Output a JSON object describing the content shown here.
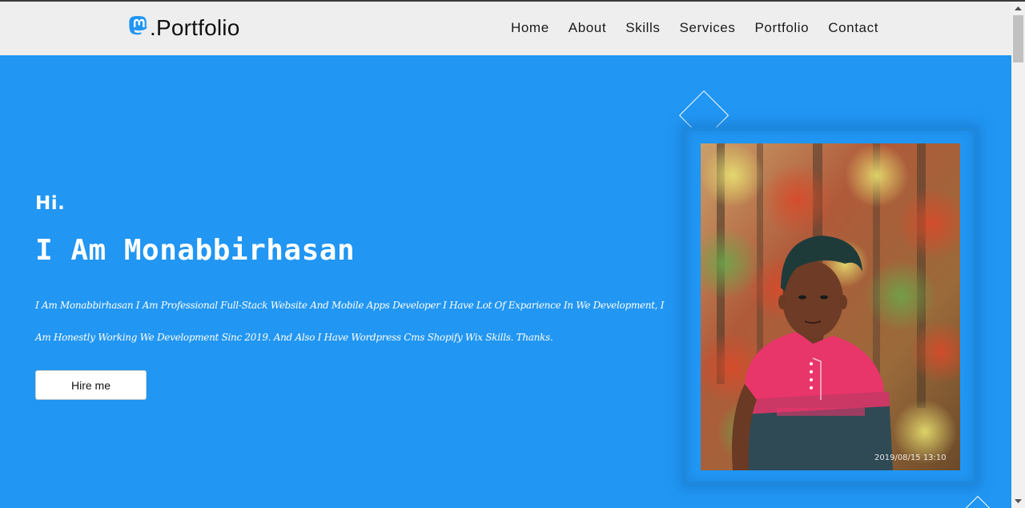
{
  "header": {
    "brand_icon": "mastodon-logo-icon",
    "brand_text": ".Portfolio",
    "nav": [
      {
        "label": "Home"
      },
      {
        "label": "About"
      },
      {
        "label": "Skills"
      },
      {
        "label": "Services"
      },
      {
        "label": "Portfolio"
      },
      {
        "label": "Contact"
      }
    ]
  },
  "hero": {
    "greeting": "Hi.",
    "name": "I Am Monabbirhasan",
    "description": "I Am Monabbirhasan I Am Professional Full-Stack Website And Mobile Apps Developer I Have Lot Of Exparience In We Development, I Am Honestly Working We Development Sinc 2019. And Also I Have Wordpress Cms Shopify Wix Skills. Thanks.",
    "hire_button": "Hire me",
    "photo_timestamp": "2019/08/15  13:10"
  },
  "colors": {
    "hero_bg": "#2196f3",
    "navbar_bg": "#eeeeee",
    "brand_icon": "#2196f3"
  }
}
